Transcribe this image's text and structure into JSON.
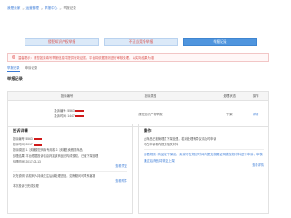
{
  "breadcrumb": {
    "items": [
      "我是卖家",
      "运营管理",
      "举报中心",
      "举报记录"
    ],
    "sep": ">"
  },
  "tabs": [
    {
      "label": "侵犯知识产权举报",
      "active": false
    },
    {
      "label": "不正当竞争举报",
      "active": false
    },
    {
      "label": "举报记录",
      "active": true
    }
  ],
  "notice": {
    "icon": "info-icon",
    "text": "温馨提示：请您如实填写举报信息并提供有效证据，平台将依据规则进行审核处理，以实际结果为准"
  },
  "subtabs": [
    {
      "label": "举报记录",
      "active": true
    },
    {
      "label": "申诉记录",
      "active": false
    }
  ],
  "section_title": "举报记录",
  "table": {
    "headers": [
      "投诉编号",
      "投诉类型",
      "处理状态",
      "操作"
    ],
    "row": {
      "line1_label": "投诉编号: 5563",
      "line2_label": "投诉时间: 1447",
      "type": "侵犯知识产权举报",
      "status": "下架",
      "op": "详情"
    }
  },
  "info_panel": {
    "title": "投诉详情",
    "lines": [
      "投诉编号: 5563",
      "投诉时间: 2017",
      "投诉原因: 1. 涉嫌侵犯商标专用权 2. 涉嫌售卖假冒商品",
      "处理结果: 平台根据投诉信息判定该商品已构成侵权，已做下架处理",
      "处理时间: 2017-03-13"
    ],
    "link1": "查看凭证",
    "extra": "补充说明: 请权利人持续关注后续处理进度，如有疑问可联系客服",
    "link2": "查看附件",
    "footer": "本次投诉已完成处理"
  },
  "ops_panel": {
    "title": "操作",
    "lines": [
      "此商品已被管理员下架处理，若对处理有异议请及时申诉",
      "可在申诉期内提交相关材料"
    ],
    "highlight": "查看规则: 商品被下架后，卖家可在规定时间内提交权属证明或授权材料进行申诉，审核通过后商品将恢复上架",
    "link": "查看详情"
  },
  "colors": {
    "accent": "#3b7bd6",
    "tab_active": "#4f95de",
    "notice_red": "#d9534f",
    "redaction": "#d01a1a"
  }
}
